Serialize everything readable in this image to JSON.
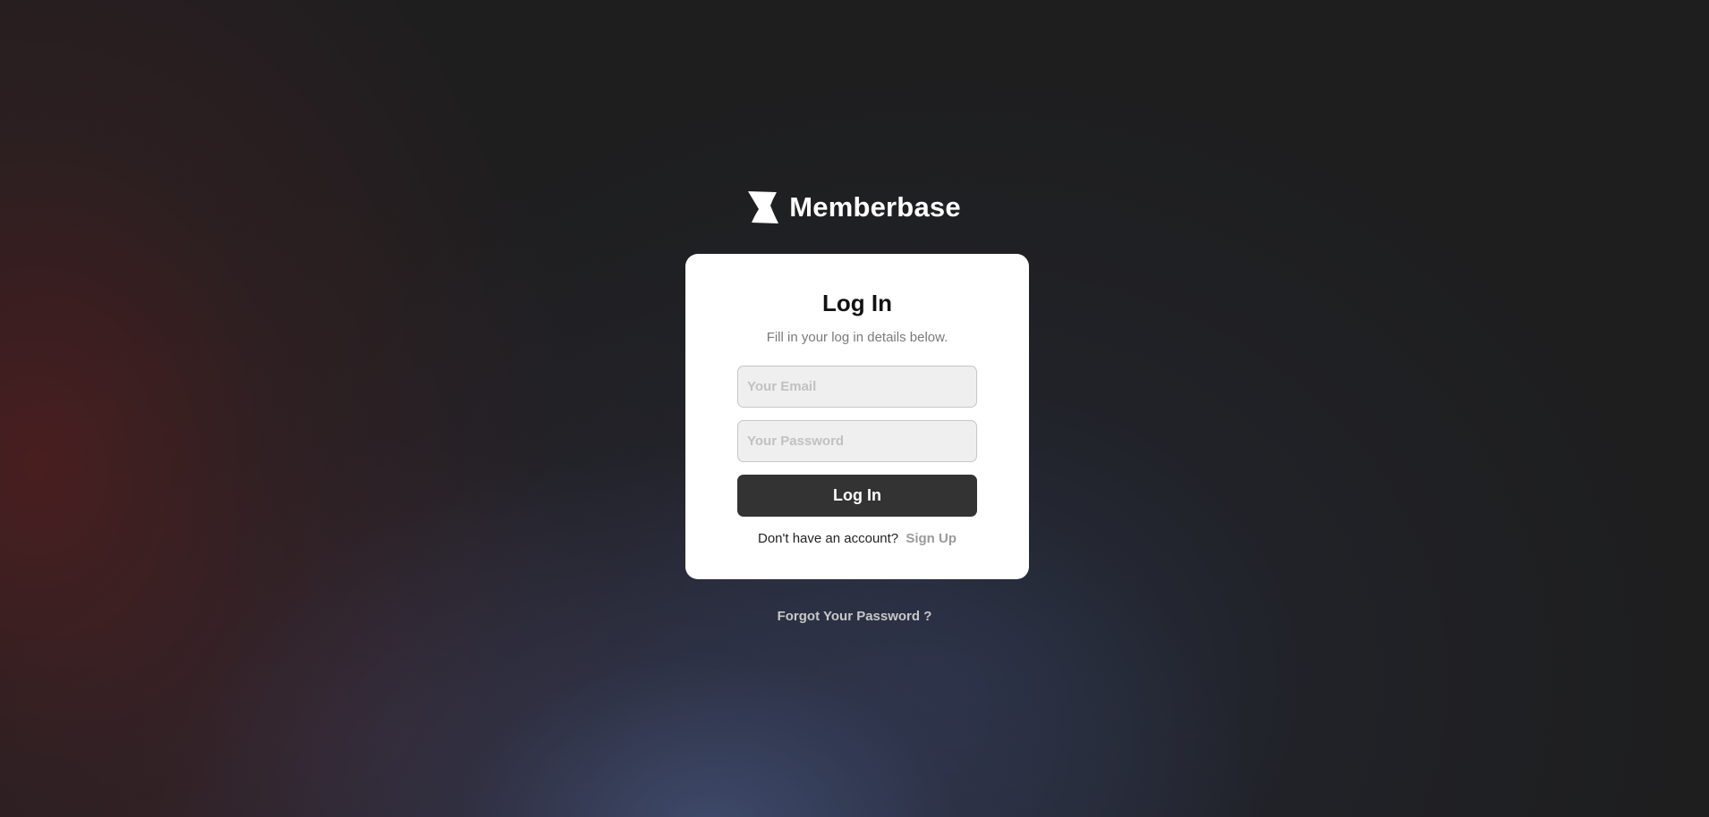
{
  "brand": {
    "name": "Memberbase",
    "logo_icon": "memberbase-logo-icon"
  },
  "login_card": {
    "title": "Log In",
    "subtitle": "Fill in your log in details below.",
    "email_placeholder": "Your Email",
    "password_placeholder": "Your Password",
    "submit_label": "Log In",
    "no_account_text": "Don't have an account?",
    "signup_label": "Sign Up"
  },
  "forgot_password_label": "Forgot Your Password ?",
  "colors": {
    "card_background": "#ffffff",
    "button_background": "#333333",
    "input_background": "#efefef",
    "page_background": "#1e1e1f"
  }
}
